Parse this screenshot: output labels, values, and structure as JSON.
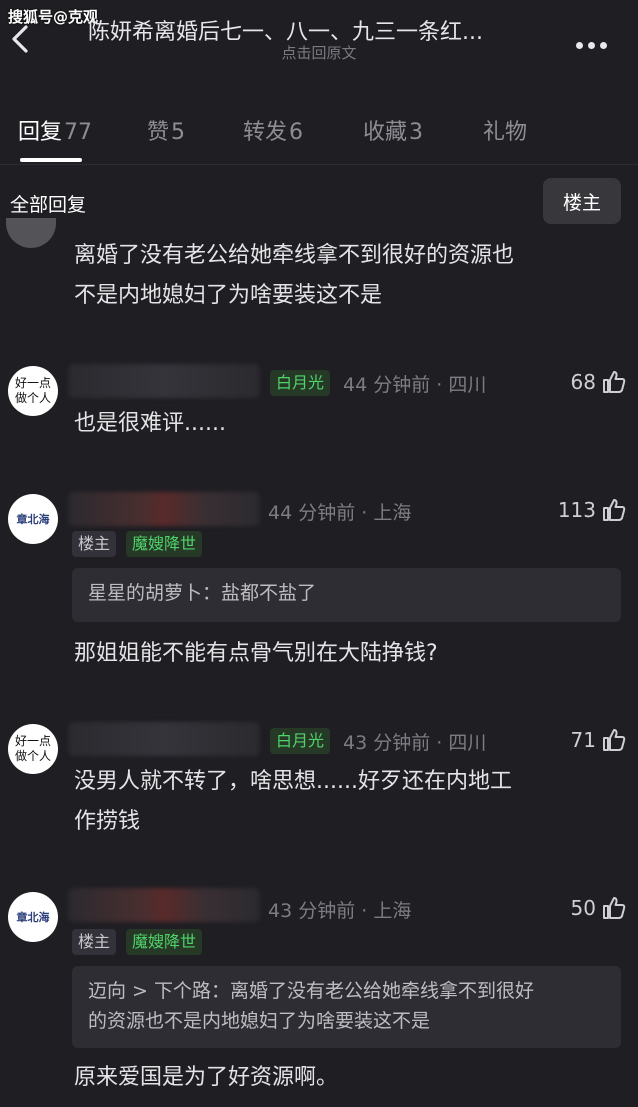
{
  "watermark": "搜狐号@克观",
  "header": {
    "title": "陈妍希离婚后七一、八一、九三一条红...",
    "subtitle": "点击回原文"
  },
  "tabs": [
    {
      "label": "回复",
      "count": "77",
      "active": true
    },
    {
      "label": "赞",
      "count": "5"
    },
    {
      "label": "转发",
      "count": "6"
    },
    {
      "label": "收藏",
      "count": "3"
    },
    {
      "label": "礼物",
      "count": ""
    }
  ],
  "filter": {
    "all_label": "全部回复",
    "op_label": "楼主"
  },
  "comments": [
    {
      "text_lines": [
        "离婚了没有老公给她牵线拿不到很好的资源也",
        "不是内地媳妇了为啥要装这不是"
      ]
    },
    {
      "avatar_text": "好一点\n做个人",
      "badge": "白月光",
      "meta": "44 分钟前 · 四川",
      "likes": "68",
      "text_lines": [
        "也是很难评......"
      ]
    },
    {
      "avatar_text": "章北海",
      "meta": "44 分钟前 · 上海",
      "likes": "113",
      "tags": [
        "楼主",
        "魔嫂降世"
      ],
      "quote": {
        "name": "星星的胡萝卜：",
        "text": "盐都不盐了"
      },
      "text_lines": [
        "那姐姐能不能有点骨气别在大陆挣钱?"
      ]
    },
    {
      "avatar_text": "好一点\n做个人",
      "badge": "白月光",
      "meta": "43 分钟前 · 四川",
      "likes": "71",
      "text_lines": [
        "没男人就不转了，啥思想......好歹还在内地工",
        "作捞钱"
      ]
    },
    {
      "avatar_text": "章北海",
      "meta": "43 分钟前 · 上海",
      "likes": "50",
      "tags": [
        "楼主",
        "魔嫂降世"
      ],
      "quote": {
        "name": "迈向 > 下个路：",
        "text_lines": [
          "离婚了没有老公给她牵线拿不到很好",
          "的资源也不是内地媳妇了为啥要装这不是"
        ]
      },
      "text_lines": [
        "原来爱国是为了好资源啊。"
      ]
    }
  ],
  "colors": {
    "background": "#1f1e23",
    "badge_green": "#4fd46a",
    "card": "#2e2d33"
  },
  "icons": [
    "back-chevron-icon",
    "more-dots-icon",
    "thumbs-up-icon"
  ]
}
